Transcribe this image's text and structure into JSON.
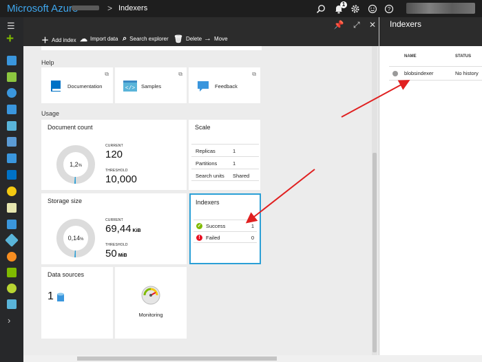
{
  "topbar": {
    "brand": "Microsoft Azure",
    "breadcrumb_sep": ">",
    "breadcrumb": "Indexers",
    "notification_count": "1"
  },
  "commands": {
    "add_index": "Add index",
    "import_data": "Import data",
    "search_explorer": "Search explorer",
    "delete": "Delete",
    "move": "Move"
  },
  "help": {
    "section_label": "Help",
    "documentation": "Documentation",
    "samples": "Samples",
    "feedback": "Feedback"
  },
  "usage": {
    "section_label": "Usage",
    "document_count": {
      "title": "Document count",
      "donut_label": "1,2",
      "donut_unit": "%",
      "current_label": "CURRENT",
      "current_value": "120",
      "threshold_label": "THRESHOLD",
      "threshold_value": "10,000",
      "fill_fraction": 0.012
    },
    "storage_size": {
      "title": "Storage size",
      "donut_label": "0,14",
      "donut_unit": "%",
      "current_label": "CURRENT",
      "current_value": "69,44",
      "current_unit": "KiB",
      "threshold_label": "THRESHOLD",
      "threshold_value": "50",
      "threshold_unit": "MiB",
      "fill_fraction": 0.0014
    },
    "scale": {
      "title": "Scale",
      "rows": [
        {
          "key": "Replicas",
          "value": "1"
        },
        {
          "key": "Partitions",
          "value": "1"
        },
        {
          "key": "Search units",
          "value": "Shared"
        }
      ]
    },
    "indexers": {
      "title": "Indexers",
      "rows": [
        {
          "key": "Success",
          "value": "1",
          "status": "success"
        },
        {
          "key": "Failed",
          "value": "0",
          "status": "error"
        }
      ]
    },
    "data_sources": {
      "title": "Data sources",
      "count": "1"
    },
    "monitoring": {
      "label": "Monitoring"
    }
  },
  "right_panel": {
    "title": "Indexers",
    "columns": {
      "name": "NAME",
      "status": "STATUS"
    },
    "rows": [
      {
        "name": "blobsindexer",
        "status": "No history"
      }
    ]
  },
  "colors": {
    "brand_blue": "#3fa7ee",
    "accent_blue": "#2a9fd6",
    "success_green": "#7fba00",
    "error_red": "#e81123",
    "annotation_red": "#e02020",
    "donut_gray": "#dcdcdc"
  }
}
